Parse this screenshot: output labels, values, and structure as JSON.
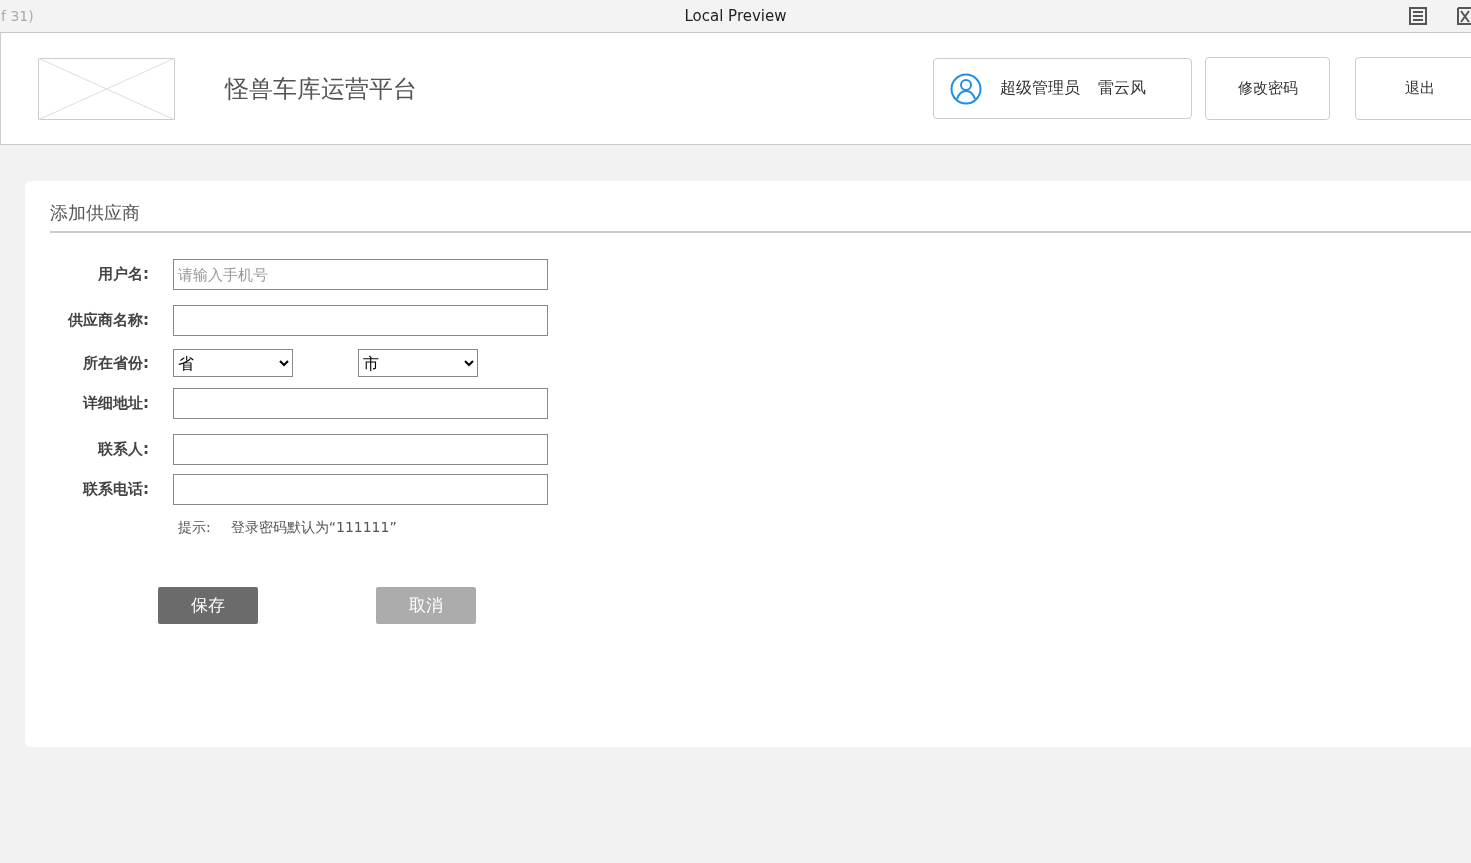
{
  "window": {
    "counter": "f 31)",
    "title": "Local Preview"
  },
  "header": {
    "title": "怪兽车库运营平台",
    "user": {
      "role": "超级管理员",
      "name": "雷云风"
    },
    "buttons": [
      "修改密码",
      "退出"
    ]
  },
  "form": {
    "title": "添加供应商",
    "fields": [
      {
        "kind": "text",
        "label": "用户名:",
        "placeholder": "请输入手机号"
      },
      {
        "kind": "text",
        "label": "供应商名称:"
      },
      {
        "kind": "selects",
        "label": "所在省份:",
        "selects": [
          "省",
          "市"
        ]
      },
      {
        "kind": "text",
        "label": "详细地址:"
      },
      {
        "kind": "text",
        "label": "联系人:"
      },
      {
        "kind": "text",
        "label": "联系电话:"
      }
    ],
    "hint": {
      "label": "提示:",
      "text": "登录密码默认为“111111”"
    },
    "buttons": [
      {
        "label": "保存",
        "kind": "primary"
      },
      {
        "label": "取消",
        "kind": "secondary"
      }
    ]
  }
}
